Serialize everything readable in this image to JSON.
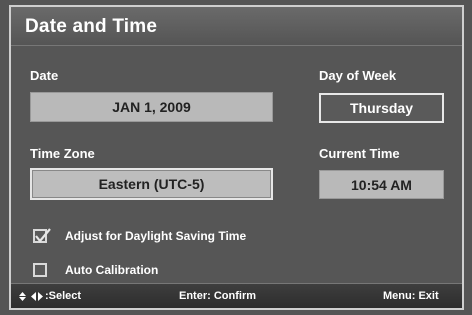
{
  "dialog": {
    "title": "Date and Time"
  },
  "date": {
    "label": "Date",
    "value": "JAN 1, 2009"
  },
  "day_of_week": {
    "label": "Day of Week",
    "value": "Thursday"
  },
  "time_zone": {
    "label": "Time Zone",
    "value": "Eastern (UTC-5)"
  },
  "current_time": {
    "label": "Current Time",
    "value": "10:54 AM"
  },
  "options": [
    {
      "label": "Adjust for Daylight Saving Time",
      "checked": true
    },
    {
      "label": "Auto Calibration",
      "checked": false
    }
  ],
  "footer": {
    "select": ":Select",
    "confirm": "Enter: Confirm",
    "exit": "Menu: Exit"
  }
}
